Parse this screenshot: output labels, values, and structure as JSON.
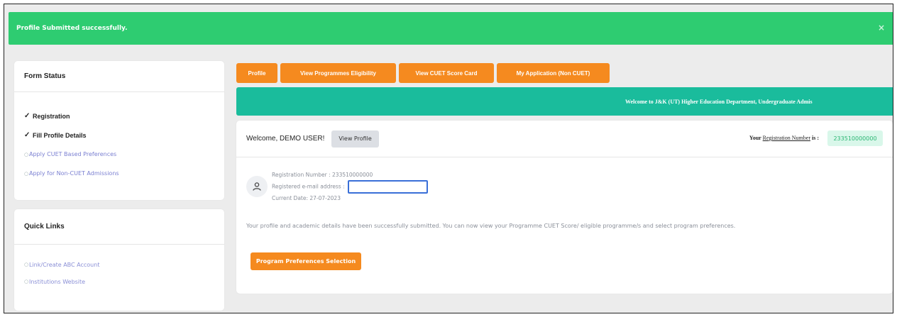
{
  "alert": {
    "message": "Profile Submitted successfully.",
    "close_symbol": "×"
  },
  "form_status": {
    "title": "Form Status",
    "items": [
      {
        "label": "Registration",
        "state": "done"
      },
      {
        "label": "Fill Profile Details",
        "state": "done"
      },
      {
        "label": "Apply CUET Based Preferences",
        "state": "todo"
      },
      {
        "label": "Apply for Non-CUET Admissions",
        "state": "todo"
      }
    ]
  },
  "quick_links": {
    "title": "Quick Links",
    "items": [
      {
        "label": "Link/Create ABC Account"
      },
      {
        "label": "Institutions Website"
      }
    ]
  },
  "tabs": [
    {
      "label": "Profile"
    },
    {
      "label": "View Programmes Eligibility"
    },
    {
      "label": "View CUET Score Card"
    },
    {
      "label": "My Application (Non CUET)"
    }
  ],
  "banner": {
    "text": "Welcome to J&K (UT) Higher Education Department, Undergraduate Admis"
  },
  "main": {
    "welcome": "Welcome, DEMO USER!",
    "view_profile": "View Profile",
    "reg_prefix": "Your",
    "reg_link": "Registration Number",
    "reg_suffix": "is :",
    "reg_number": "233510000000",
    "reg_number_line": "Registration Number : 233510000000",
    "email_label": "Registered e-mail address :",
    "current_date": "Current Date: 27-07-2023",
    "submitted_message": "Your profile and academic details have been successfully submitted. You can now view your Programme CUET Score/ eligible programme/s and select program preferences.",
    "pref_button": "Program Preferences Selection"
  },
  "colors": {
    "success": "#2ecc71",
    "accent": "#f58a1f",
    "banner": "#1abc9c",
    "link": "#7a7fd1"
  }
}
